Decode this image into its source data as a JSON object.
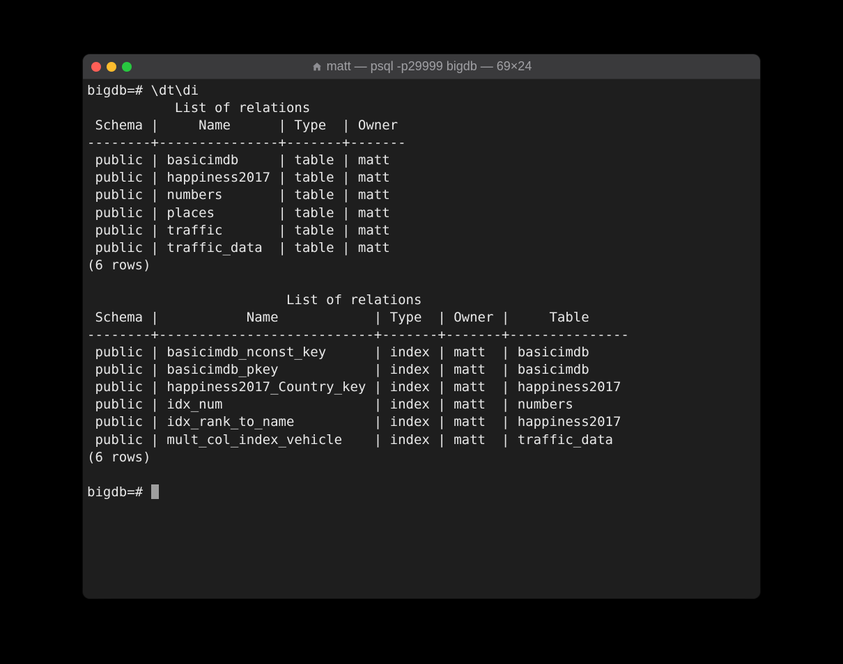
{
  "window": {
    "title": "matt — psql -p29999 bigdb — 69×24"
  },
  "terminal": {
    "prompt": "bigdb=#",
    "command": "\\dt\\di",
    "section1": {
      "title": "List of relations",
      "headers": [
        "Schema",
        "Name",
        "Type",
        "Owner"
      ],
      "rows": [
        {
          "schema": "public",
          "name": "basicimdb",
          "type": "table",
          "owner": "matt"
        },
        {
          "schema": "public",
          "name": "happiness2017",
          "type": "table",
          "owner": "matt"
        },
        {
          "schema": "public",
          "name": "numbers",
          "type": "table",
          "owner": "matt"
        },
        {
          "schema": "public",
          "name": "places",
          "type": "table",
          "owner": "matt"
        },
        {
          "schema": "public",
          "name": "traffic",
          "type": "table",
          "owner": "matt"
        },
        {
          "schema": "public",
          "name": "traffic_data",
          "type": "table",
          "owner": "matt"
        }
      ],
      "footer": "(6 rows)"
    },
    "section2": {
      "title": "List of relations",
      "headers": [
        "Schema",
        "Name",
        "Type",
        "Owner",
        "Table"
      ],
      "rows": [
        {
          "schema": "public",
          "name": "basicimdb_nconst_key",
          "type": "index",
          "owner": "matt",
          "table": "basicimdb"
        },
        {
          "schema": "public",
          "name": "basicimdb_pkey",
          "type": "index",
          "owner": "matt",
          "table": "basicimdb"
        },
        {
          "schema": "public",
          "name": "happiness2017_Country_key",
          "type": "index",
          "owner": "matt",
          "table": "happiness2017"
        },
        {
          "schema": "public",
          "name": "idx_num",
          "type": "index",
          "owner": "matt",
          "table": "numbers"
        },
        {
          "schema": "public",
          "name": "idx_rank_to_name",
          "type": "index",
          "owner": "matt",
          "table": "happiness2017"
        },
        {
          "schema": "public",
          "name": "mult_col_index_vehicle",
          "type": "index",
          "owner": "matt",
          "table": "traffic_data"
        }
      ],
      "footer": "(6 rows)"
    },
    "final_prompt": "bigdb=# "
  },
  "col_widths": {
    "s1": {
      "schema": 8,
      "name": 15,
      "type": 7,
      "owner": 7
    },
    "s2": {
      "schema": 8,
      "name": 27,
      "type": 7,
      "owner": 7,
      "table": 15
    }
  }
}
